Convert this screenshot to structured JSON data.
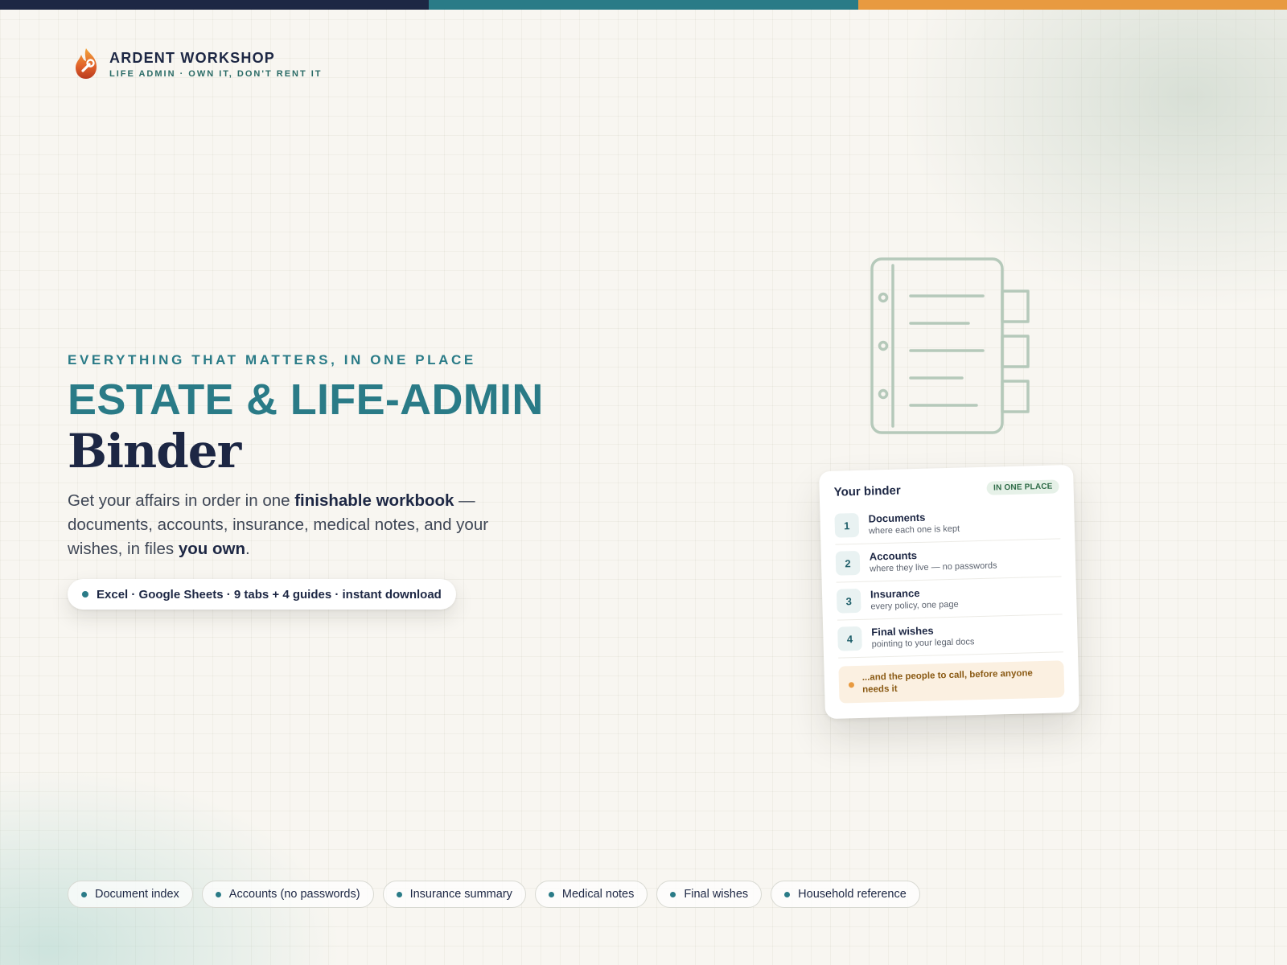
{
  "colors": {
    "stripe_navy": "#1d2744",
    "stripe_teal": "#2a7b87",
    "stripe_orange": "#e89a40",
    "accent_teal": "#2a7b87",
    "ink_navy": "#1d2744"
  },
  "brand": {
    "logo_icon": "flame-wrench-icon",
    "name": "ARDENT WORKSHOP",
    "tagline": "LIFE ADMIN · OWN IT, DON'T RENT IT"
  },
  "hero": {
    "eyebrow": "EVERYTHING THAT MATTERS, IN ONE PLACE",
    "title_main": "ESTATE & LIFE-ADMIN",
    "title_sub": "Binder",
    "lede": {
      "part1": "Get your affairs in order in one ",
      "bold1": "finishable workbook",
      "part2": " — documents, accounts, insurance, medical notes, and your wishes, in files ",
      "bold2": "you own",
      "part3": "."
    },
    "format_pill": "Excel · Google Sheets · 9 tabs + 4 guides · instant download"
  },
  "illustration": {
    "icon": "binder-icon"
  },
  "card": {
    "title": "Your binder",
    "badge": "IN ONE PLACE",
    "rows": [
      {
        "num": "1",
        "title": "Documents",
        "sub": "where each one is kept"
      },
      {
        "num": "2",
        "title": "Accounts",
        "sub": "where they live — no passwords"
      },
      {
        "num": "3",
        "title": "Insurance",
        "sub": "every policy, one page"
      },
      {
        "num": "4",
        "title": "Final wishes",
        "sub": "pointing to your legal docs"
      }
    ],
    "note": "...and the people to call, before anyone needs it"
  },
  "chips": [
    {
      "label": "Document index"
    },
    {
      "label": "Accounts (no passwords)"
    },
    {
      "label": "Insurance summary"
    },
    {
      "label": "Medical notes"
    },
    {
      "label": "Final wishes"
    },
    {
      "label": "Household reference"
    }
  ]
}
